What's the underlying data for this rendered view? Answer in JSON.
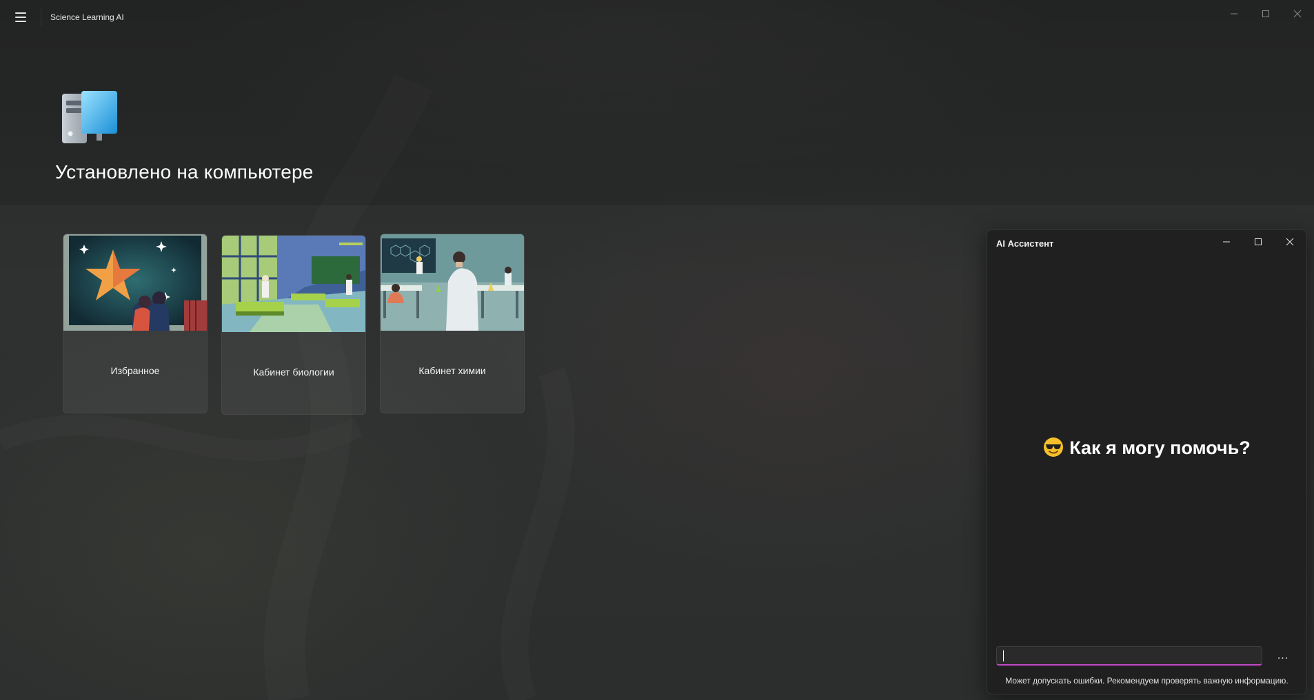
{
  "app": {
    "title": "Science Learning AI"
  },
  "window_controls": {
    "minimize_icon": "minimize-icon",
    "maximize_icon": "maximize-icon",
    "close_icon": "close-icon"
  },
  "header": {
    "title": "Установлено на компьютере",
    "icon": "computer-icon"
  },
  "cards": [
    {
      "label": "Избранное",
      "image": "star-classroom-illustration"
    },
    {
      "label": "Кабинет биологии",
      "image": "biology-lab-illustration"
    },
    {
      "label": "Кабинет химии",
      "image": "chemistry-lab-illustration"
    }
  ],
  "assistant": {
    "title": "AI Ассистент",
    "greeting": "Как я могу помочь?",
    "greeting_emoji": "sunglasses-face-icon",
    "input_value": "",
    "more_label": "...",
    "disclaimer": "Может допускать ошибки. Рекомендуем проверять важную информацию."
  },
  "colors": {
    "accent_underline": "#c048c8",
    "panel_bg": "#202020",
    "app_bg": "#2b2d2d"
  }
}
